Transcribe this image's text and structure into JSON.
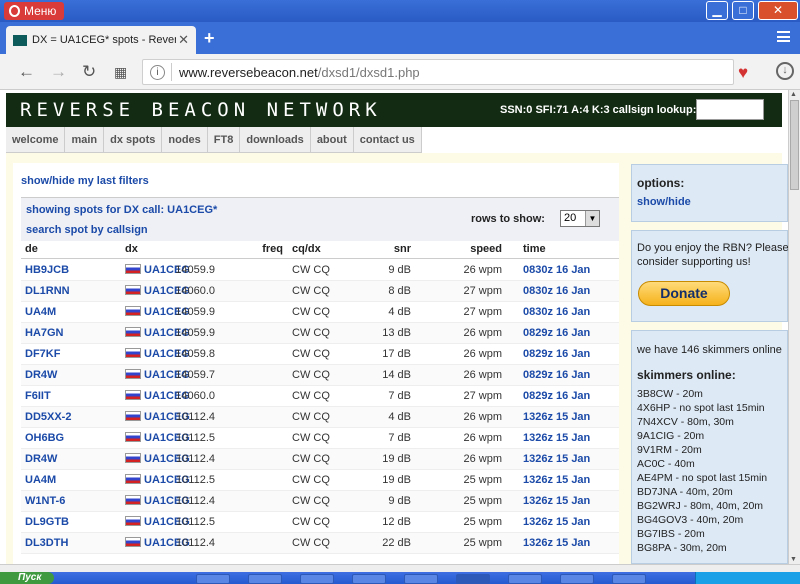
{
  "browser": {
    "menu_label": "Меню",
    "tab_title": "DX = UA1CEG* spots - Reverse",
    "new_tab": "+",
    "url_host": "www.reversebeacon.net",
    "url_path": "/dxsd1/dxsd1.php",
    "window_buttons": {
      "minimize": "▁",
      "maximize": "□",
      "close": "✕"
    }
  },
  "site": {
    "logo": "REVERSE BEACON NETWORK",
    "status": "SSN:0 SFI:71 A:4 K:3 callsign lookup:",
    "nav": [
      "welcome",
      "main",
      "dx spots",
      "nodes",
      "FT8",
      "downloads",
      "about",
      "contact us"
    ]
  },
  "main": {
    "show_hide_filters": "show/hide my last filters",
    "spots_title": "showing spots for DX call: UA1CEG*",
    "search_by_callsign": "search spot by callsign",
    "rows_label": "rows to show:",
    "rows_value": "20",
    "columns": {
      "de": "de",
      "dx": "dx",
      "freq": "freq",
      "cqdx": "cq/dx",
      "snr": "snr",
      "speed": "speed",
      "time": "time"
    },
    "rows": [
      {
        "de": "HB9JCB",
        "dx": "UA1CEG",
        "freq": "14059.9",
        "mode": "CW CQ",
        "snr": "9 dB",
        "speed": "26 wpm",
        "time": "0830z 16 Jan"
      },
      {
        "de": "DL1RNN",
        "dx": "UA1CEG",
        "freq": "14060.0",
        "mode": "CW CQ",
        "snr": "8 dB",
        "speed": "27 wpm",
        "time": "0830z 16 Jan"
      },
      {
        "de": "UA4M",
        "dx": "UA1CEG",
        "freq": "14059.9",
        "mode": "CW CQ",
        "snr": "4 dB",
        "speed": "27 wpm",
        "time": "0830z 16 Jan"
      },
      {
        "de": "HA7GN",
        "dx": "UA1CEG",
        "freq": "14059.9",
        "mode": "CW CQ",
        "snr": "13 dB",
        "speed": "26 wpm",
        "time": "0829z 16 Jan"
      },
      {
        "de": "DF7KF",
        "dx": "UA1CEG",
        "freq": "14059.8",
        "mode": "CW CQ",
        "snr": "17 dB",
        "speed": "26 wpm",
        "time": "0829z 16 Jan"
      },
      {
        "de": "DR4W",
        "dx": "UA1CEG",
        "freq": "14059.7",
        "mode": "CW CQ",
        "snr": "14 dB",
        "speed": "26 wpm",
        "time": "0829z 16 Jan"
      },
      {
        "de": "F6IIT",
        "dx": "UA1CEG",
        "freq": "14060.0",
        "mode": "CW CQ",
        "snr": "7 dB",
        "speed": "27 wpm",
        "time": "0829z 16 Jan"
      },
      {
        "de": "DD5XX-2",
        "dx": "UA1CEG",
        "freq": "10112.4",
        "mode": "CW CQ",
        "snr": "4 dB",
        "speed": "26 wpm",
        "time": "1326z 15 Jan"
      },
      {
        "de": "OH6BG",
        "dx": "UA1CEG",
        "freq": "10112.5",
        "mode": "CW CQ",
        "snr": "7 dB",
        "speed": "26 wpm",
        "time": "1326z 15 Jan"
      },
      {
        "de": "DR4W",
        "dx": "UA1CEG",
        "freq": "10112.4",
        "mode": "CW CQ",
        "snr": "19 dB",
        "speed": "26 wpm",
        "time": "1326z 15 Jan"
      },
      {
        "de": "UA4M",
        "dx": "UA1CEG",
        "freq": "10112.5",
        "mode": "CW CQ",
        "snr": "19 dB",
        "speed": "25 wpm",
        "time": "1326z 15 Jan"
      },
      {
        "de": "W1NT-6",
        "dx": "UA1CEG",
        "freq": "10112.4",
        "mode": "CW CQ",
        "snr": "9 dB",
        "speed": "25 wpm",
        "time": "1326z 15 Jan"
      },
      {
        "de": "DL9GTB",
        "dx": "UA1CEG",
        "freq": "10112.5",
        "mode": "CW CQ",
        "snr": "12 dB",
        "speed": "25 wpm",
        "time": "1326z 15 Jan"
      },
      {
        "de": "DL3DTH",
        "dx": "UA1CEG",
        "freq": "10112.4",
        "mode": "CW CQ",
        "snr": "22 dB",
        "speed": "25 wpm",
        "time": "1326z 15 Jan"
      }
    ]
  },
  "sidebar": {
    "options_title": "options:",
    "options_link": "show/hide",
    "donate_text": "Do you enjoy the RBN? Please consider supporting us!",
    "donate_button": "Donate",
    "skimmer_count": "we have 146 skimmers online",
    "skimmers_title": "skimmers online:",
    "skimmers": [
      "3B8CW - 20m",
      "4X6HP - no spot last 15min",
      "7N4XCV - 80m, 30m",
      "9A1CIG - 20m",
      "9V1RM - 20m",
      "AC0C - 40m",
      "AE4PM - no spot last 15min",
      "BD7JNA - 40m, 20m",
      "BG2WRJ - 80m, 40m, 20m",
      "BG4GOV3 - 40m, 20m",
      "BG7IBS - 20m",
      "BG8PA - 30m, 20m"
    ]
  },
  "taskbar": {
    "start_label": "Пуск"
  }
}
